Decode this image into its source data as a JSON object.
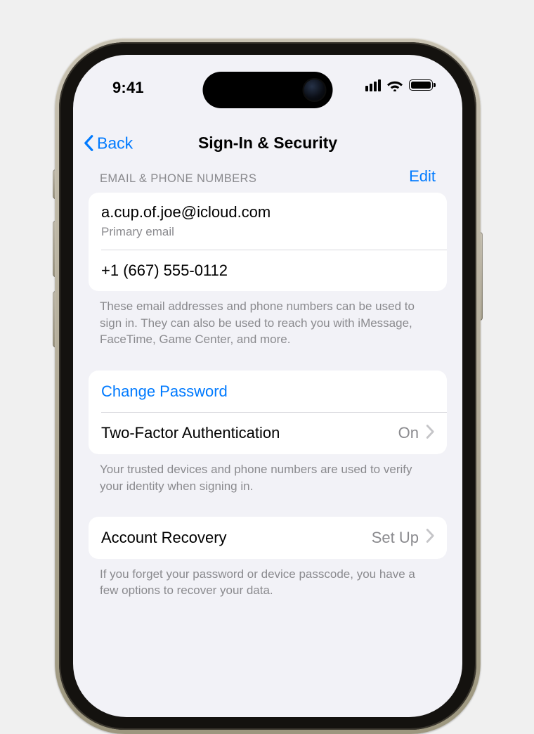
{
  "status": {
    "time": "9:41"
  },
  "nav": {
    "back": "Back",
    "title": "Sign-In & Security"
  },
  "email_phone": {
    "header": "EMAIL & PHONE NUMBERS",
    "edit": "Edit",
    "email": "a.cup.of.joe@icloud.com",
    "email_subtitle": "Primary email",
    "phone": "+1 (667) 555-0112",
    "caption": "These email addresses and phone numbers can be used to sign in. They can also be used to reach you with iMessage, FaceTime, Game Center, and more."
  },
  "password_section": {
    "change_password": "Change Password",
    "two_factor_label": "Two-Factor Authentication",
    "two_factor_value": "On",
    "caption": "Your trusted devices and phone numbers are used to verify your identity when signing in."
  },
  "recovery_section": {
    "label": "Account Recovery",
    "value": "Set Up",
    "caption": "If you forget your password or device passcode, you have a few options to recover your data."
  }
}
